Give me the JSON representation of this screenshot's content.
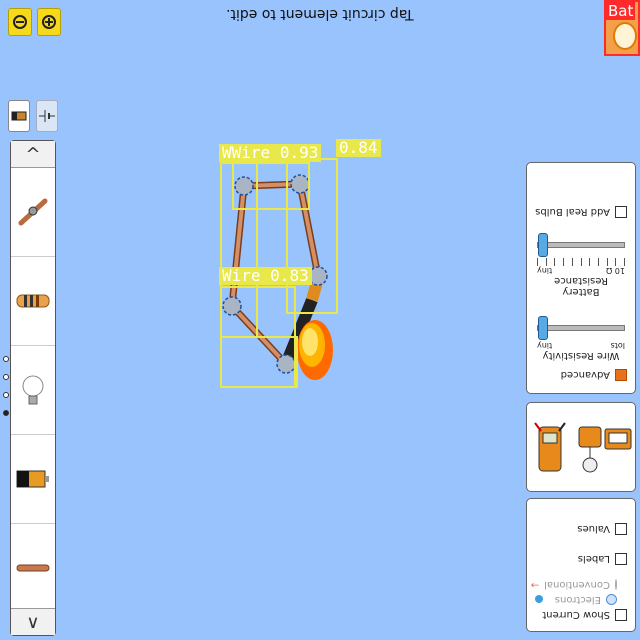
{
  "header": {
    "hint": "Tap circuit element to edit.",
    "zoom_out_icon": "zoom-out-icon",
    "zoom_in_icon": "zoom-in-icon"
  },
  "detection_badge": {
    "label": "Bat"
  },
  "toolbox": {
    "items": [
      "wire-icon",
      "resistor-icon",
      "light-bulb-icon",
      "battery-icon",
      "wire-segment-icon"
    ],
    "up_arrow": "^",
    "down_arrow": "v"
  },
  "detections": [
    {
      "label": "WWire",
      "score": "0.93"
    },
    {
      "label": "",
      "score": "0.84"
    },
    {
      "label": "Wire",
      "score": "0.83"
    }
  ],
  "controls_panel": {
    "add_real_bulbs": "Add Real Bulbs",
    "battery_resistance_label": "Battery Resistance",
    "battery_resistance_min": "tiny",
    "battery_resistance_max": "10 Ω",
    "wire_resistivity_label": "Wire Resistivity",
    "wire_resistivity_min": "tiny",
    "wire_resistivity_max": "lots",
    "advanced": "Advanced"
  },
  "view_panel": {
    "values": "Values",
    "labels": "Labels",
    "conventional": "Conventional",
    "electrons": "Electrons",
    "show_current": "Show Current"
  },
  "colors": {
    "background": "#99c3fd",
    "detection": "#e8e84a",
    "badge": "#ff2a2a"
  }
}
